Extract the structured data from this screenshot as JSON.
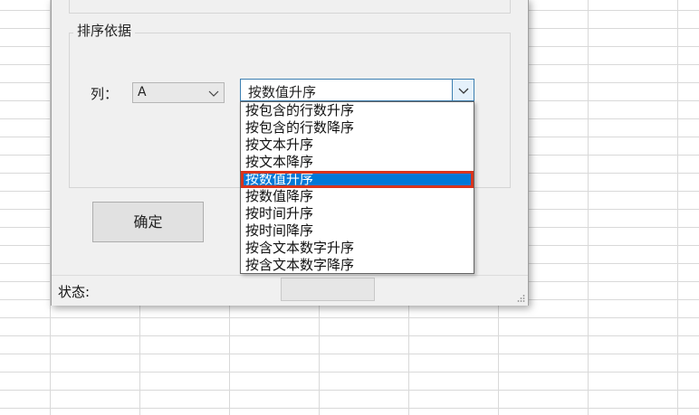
{
  "dialog": {
    "group_title": "排序依据",
    "column_label": "列：",
    "column_select": {
      "value": "A",
      "icon": "chevron-down-icon"
    },
    "order_select": {
      "value": "按数值升序",
      "icon": "chevron-down-icon"
    },
    "order_options": [
      "按包含的行数升序",
      "按包含的行数降序",
      "按文本升序",
      "按文本降序",
      "按数值升序",
      "按数值降序",
      "按时间升序",
      "按时间降序",
      "按含文本数字升序",
      "按含文本数字降序"
    ],
    "selected_index": 4,
    "ok_label": "确定",
    "status_label": "状态:",
    "status_value": ""
  },
  "colors": {
    "selection": "#0078d7",
    "highlight_border": "#d9341c",
    "dialog_bg": "#f0f0f0",
    "focus_border": "#3c7fb1"
  }
}
